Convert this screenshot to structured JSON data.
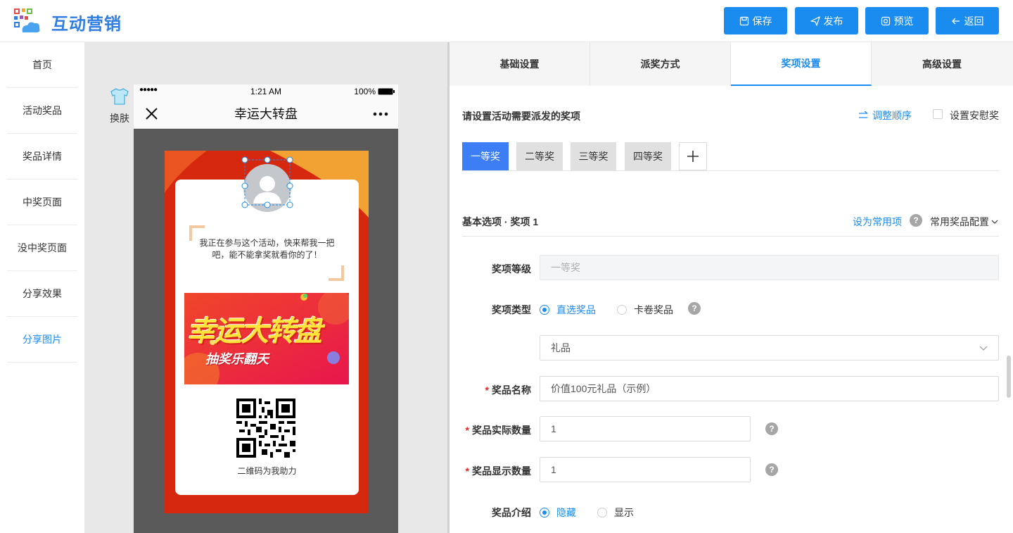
{
  "app": {
    "title": "互动营销"
  },
  "header": {
    "save": "保存",
    "publish": "发布",
    "preview": "预览",
    "back": "返回"
  },
  "nav": [
    "首页",
    "活动奖品",
    "奖品详情",
    "中奖页面",
    "没中奖页面",
    "分享效果",
    "分享图片"
  ],
  "nav_active_index": 6,
  "canvas": {
    "skin_label": "换肤",
    "phone": {
      "signal": "●●●●●",
      "time": "1:21 AM",
      "battery": "100%",
      "title": "幸运大转盘"
    },
    "poster": {
      "text_line1": "我正在参与这个活动，快来帮我一把",
      "text_line2": "吧，能不能拿奖就看你的了！",
      "banner_title": "幸运大转盘",
      "banner_subtitle": "抽奖乐翻天",
      "qr_label": "二维码为我助力"
    }
  },
  "tabs": [
    "基础设置",
    "派奖方式",
    "奖项设置",
    "高级设置"
  ],
  "tab_active_index": 2,
  "panel": {
    "heading": "请设置活动需要派发的奖项",
    "reorder": "调整顺序",
    "consolation": "设置安慰奖",
    "prize_tabs": [
      "一等奖",
      "二等奖",
      "三等奖",
      "四等奖"
    ],
    "add_icon": "plus-icon",
    "basic_title": "基本选项 · 奖项 1",
    "set_common": "设为常用项",
    "common_config": "常用奖品配置",
    "fields": {
      "level_label": "奖项等级",
      "level_value": "一等奖",
      "type_label": "奖项类型",
      "type_option1": "直选奖品",
      "type_option2": "卡卷奖品",
      "category_value": "礼品",
      "name_label": "奖品名称",
      "name_value": "价值100元礼品（示例）",
      "actual_qty_label": "奖品实际数量",
      "actual_qty_value": "1",
      "display_qty_label": "奖品显示数量",
      "display_qty_value": "1",
      "intro_label": "奖品介绍",
      "intro_option1": "隐藏",
      "intro_option2": "显示"
    }
  },
  "colors": {
    "primary": "#1a8cf0",
    "tab_active": "#3d7ef5",
    "poster_red": "#d6280f"
  }
}
